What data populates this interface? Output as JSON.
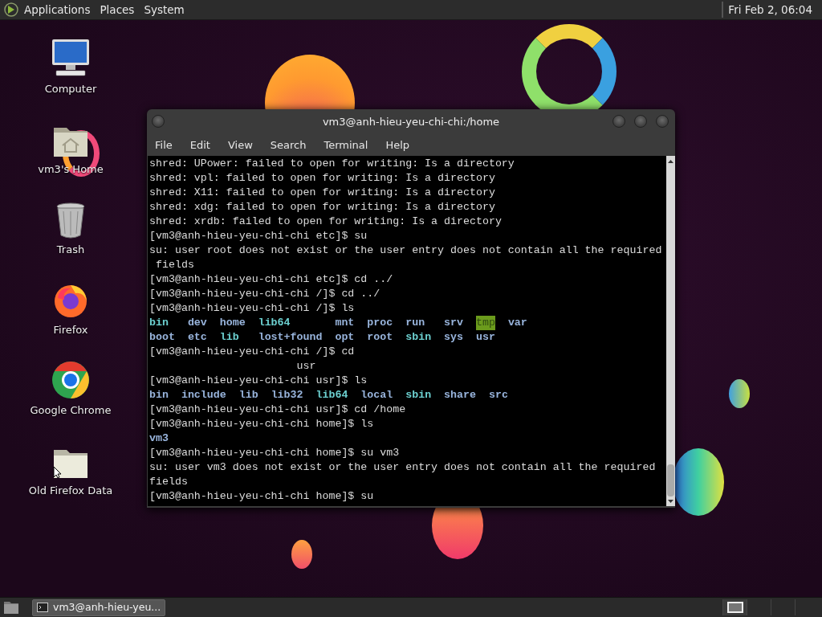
{
  "top_panel": {
    "menus": [
      "Applications",
      "Places",
      "System"
    ],
    "clock": "Fri Feb 2, 06:04"
  },
  "desktop_icons": [
    {
      "kind": "computer",
      "label": "Computer"
    },
    {
      "kind": "home",
      "label": "vm3's Home"
    },
    {
      "kind": "trash",
      "label": "Trash"
    },
    {
      "kind": "firefox",
      "label": "Firefox"
    },
    {
      "kind": "chrome",
      "label": "Google Chrome"
    },
    {
      "kind": "folder",
      "label": "Old Firefox Data"
    }
  ],
  "terminal": {
    "title": "vm3@anh-hieu-yeu-chi-chi:/home",
    "menu": [
      "File",
      "Edit",
      "View",
      "Search",
      "Terminal",
      "Help"
    ],
    "lines": [
      {
        "kind": "text",
        "text": "shred: UPower: failed to open for writing: Is a directory"
      },
      {
        "kind": "text",
        "text": "shred: vpl: failed to open for writing: Is a directory"
      },
      {
        "kind": "text",
        "text": "shred: X11: failed to open for writing: Is a directory"
      },
      {
        "kind": "text",
        "text": "shred: xdg: failed to open for writing: Is a directory"
      },
      {
        "kind": "text",
        "text": "shred: xrdb: failed to open for writing: Is a directory"
      },
      {
        "kind": "text",
        "text": "[vm3@anh-hieu-yeu-chi-chi etc]$ su"
      },
      {
        "kind": "text",
        "text": "su: user root does not exist or the user entry does not contain all the required"
      },
      {
        "kind": "text",
        "text": " fields"
      },
      {
        "kind": "text",
        "text": "[vm3@anh-hieu-yeu-chi-chi etc]$ cd ../"
      },
      {
        "kind": "text",
        "text": "[vm3@anh-hieu-yeu-chi-chi /]$ cd ../"
      },
      {
        "kind": "text",
        "text": "[vm3@anh-hieu-yeu-chi-chi /]$ ls"
      },
      {
        "kind": "ls",
        "rows": [
          [
            {
              "name": "bin",
              "kind": "link"
            },
            {
              "name": "dev",
              "kind": "dir"
            },
            {
              "name": "home",
              "kind": "dir"
            },
            {
              "name": "lib64",
              "kind": "link"
            },
            {
              "name": "mnt",
              "kind": "dir"
            },
            {
              "name": "proc",
              "kind": "dir"
            },
            {
              "name": "run",
              "kind": "dir"
            },
            {
              "name": "srv",
              "kind": "dir"
            },
            {
              "name": "tmp",
              "kind": "sticky"
            },
            {
              "name": "var",
              "kind": "dir"
            }
          ],
          [
            {
              "name": "boot",
              "kind": "dir"
            },
            {
              "name": "etc",
              "kind": "dir"
            },
            {
              "name": "lib",
              "kind": "link"
            },
            {
              "name": "lost+found",
              "kind": "dir"
            },
            {
              "name": "opt",
              "kind": "dir"
            },
            {
              "name": "root",
              "kind": "dir"
            },
            {
              "name": "sbin",
              "kind": "link"
            },
            {
              "name": "sys",
              "kind": "dir"
            },
            {
              "name": "usr",
              "kind": "dir"
            }
          ]
        ]
      },
      {
        "kind": "text",
        "text": "[vm3@anh-hieu-yeu-chi-chi /]$ cd"
      },
      {
        "kind": "text",
        "text": "                       usr"
      },
      {
        "kind": "text",
        "text": "[vm3@anh-hieu-yeu-chi-chi usr]$ ls"
      },
      {
        "kind": "ls",
        "rows": [
          [
            {
              "name": "bin",
              "kind": "dir"
            },
            {
              "name": "include",
              "kind": "dir"
            },
            {
              "name": "lib",
              "kind": "dir"
            },
            {
              "name": "lib32",
              "kind": "dir"
            },
            {
              "name": "lib64",
              "kind": "link"
            },
            {
              "name": "local",
              "kind": "dir"
            },
            {
              "name": "sbin",
              "kind": "link"
            },
            {
              "name": "share",
              "kind": "dir"
            },
            {
              "name": "src",
              "kind": "dir"
            }
          ]
        ]
      },
      {
        "kind": "text",
        "text": "[vm3@anh-hieu-yeu-chi-chi usr]$ cd /home"
      },
      {
        "kind": "text",
        "text": "[vm3@anh-hieu-yeu-chi-chi home]$ ls"
      },
      {
        "kind": "ls",
        "rows": [
          [
            {
              "name": "vm3",
              "kind": "dir"
            }
          ]
        ]
      },
      {
        "kind": "text",
        "text": "[vm3@anh-hieu-yeu-chi-chi home]$ su vm3"
      },
      {
        "kind": "text",
        "text": "su: user vm3 does not exist or the user entry does not contain all the required"
      },
      {
        "kind": "text",
        "text": "fields"
      },
      {
        "kind": "text",
        "text": "[vm3@anh-hieu-yeu-chi-chi home]$ su"
      }
    ]
  },
  "bottom_panel": {
    "task": "vm3@anh-hieu-yeu...",
    "workspaces": [
      {
        "selected": true
      },
      {
        "selected": false
      },
      {
        "selected": false
      },
      {
        "selected": false
      }
    ]
  }
}
